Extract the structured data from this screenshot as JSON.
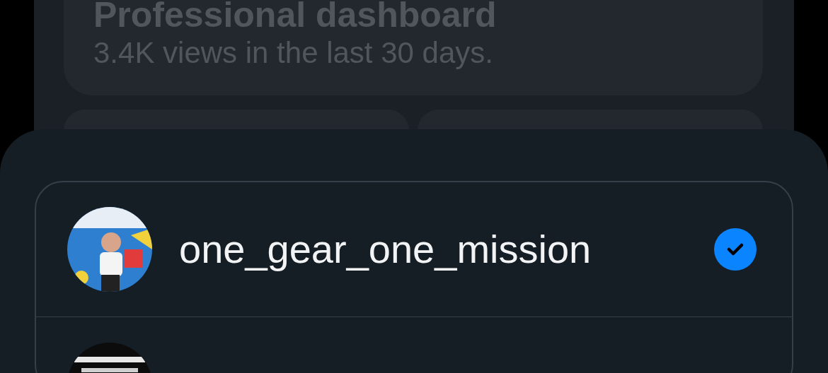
{
  "dashboard": {
    "title": "Professional dashboard",
    "subtitle": "3.4K views in the last 30 days."
  },
  "accounts": [
    {
      "avatar": {
        "kind": "picture"
      },
      "username": "one_gear_one_mission",
      "selected": true
    },
    {
      "avatar": {
        "kind": "picture"
      }
    }
  ]
}
